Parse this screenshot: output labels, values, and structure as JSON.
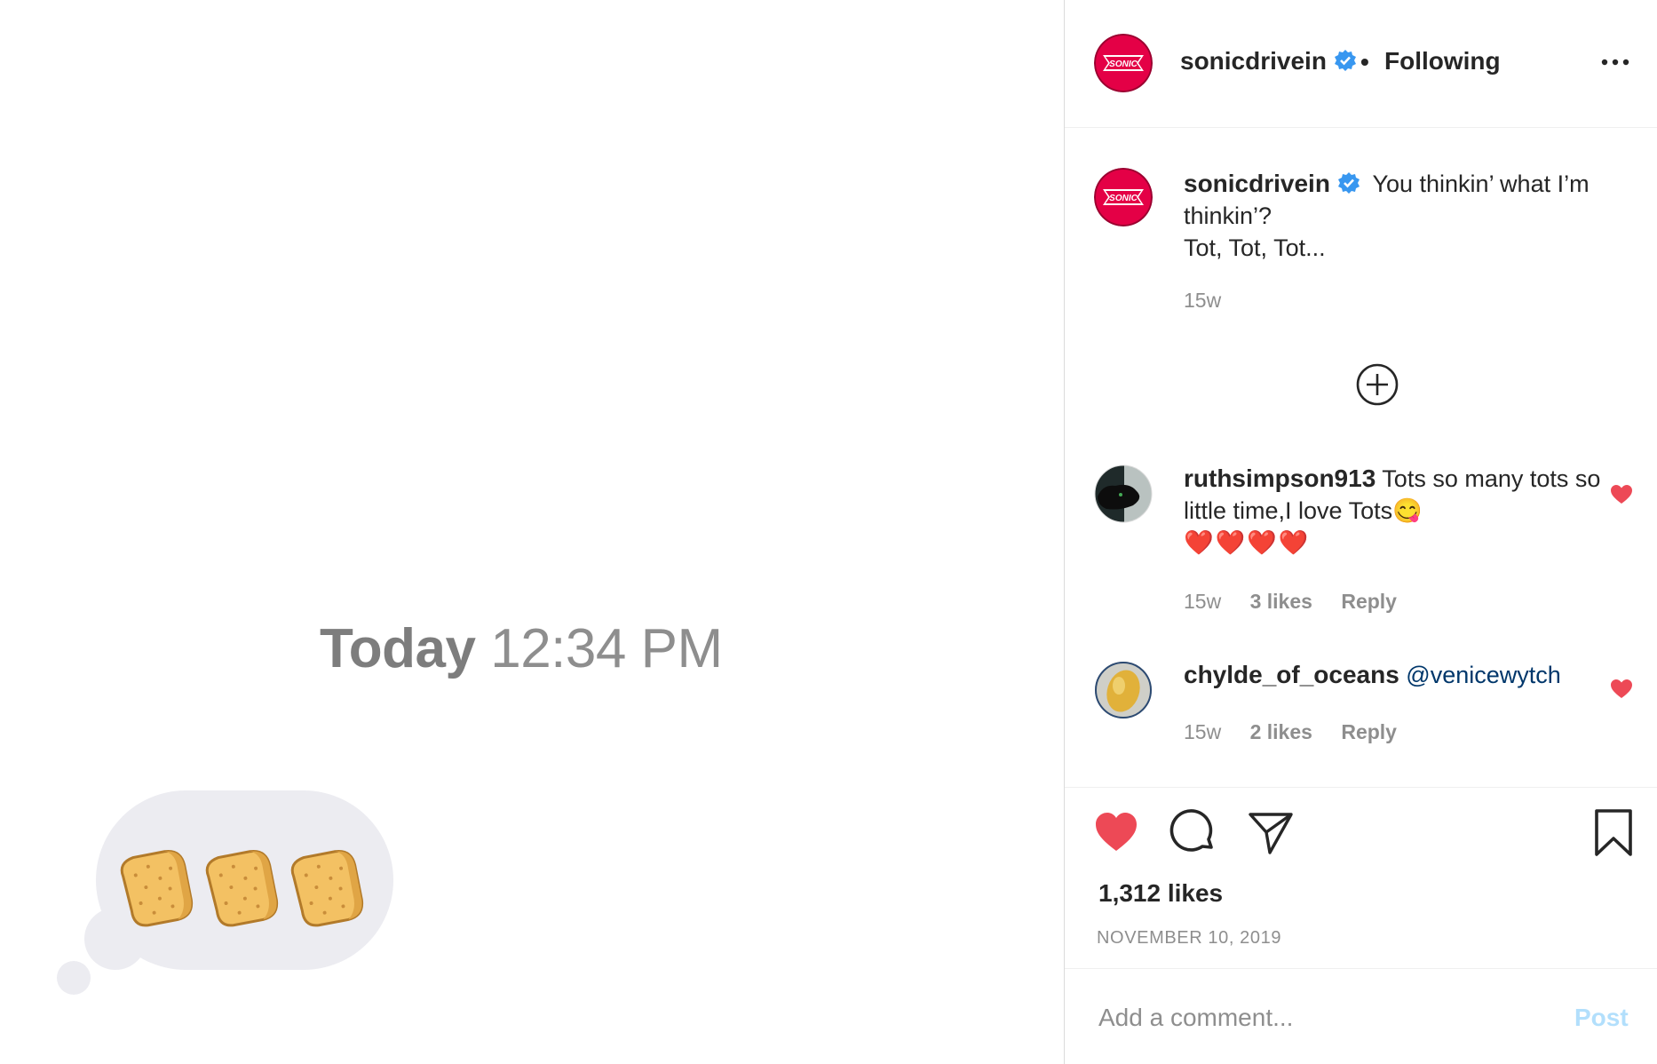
{
  "media": {
    "timestamp_bold": "Today",
    "timestamp_time": "12:34 PM"
  },
  "header": {
    "username": "sonicdrivein",
    "separator": "•",
    "follow_status": "Following",
    "avatar_text": "SONIC"
  },
  "caption": {
    "username": "sonicdrivein",
    "line1": "You thinkin’ what I’m thinkin’?",
    "line2": "Tot, Tot, Tot...",
    "time": "15w"
  },
  "comments": [
    {
      "username": "ruthsimpson913",
      "text": "Tots so many tots so little time,I love Tots😋",
      "emoji_line": "❤️❤️❤️❤️",
      "time": "15w",
      "likes": "3 likes",
      "reply": "Reply"
    },
    {
      "username": "chylde_of_oceans",
      "mention": "@venicewytch",
      "time": "15w",
      "likes": "2 likes",
      "reply": "Reply"
    }
  ],
  "post": {
    "likes": "1,312 likes",
    "date": "NOVEMBER 10, 2019"
  },
  "comment_box": {
    "placeholder": "Add a comment...",
    "post_label": "Post"
  },
  "colors": {
    "heart": "#ed4956",
    "verified": "#3897f0",
    "post_disabled": "#b2dffc",
    "sonic_red": "#e40046"
  }
}
